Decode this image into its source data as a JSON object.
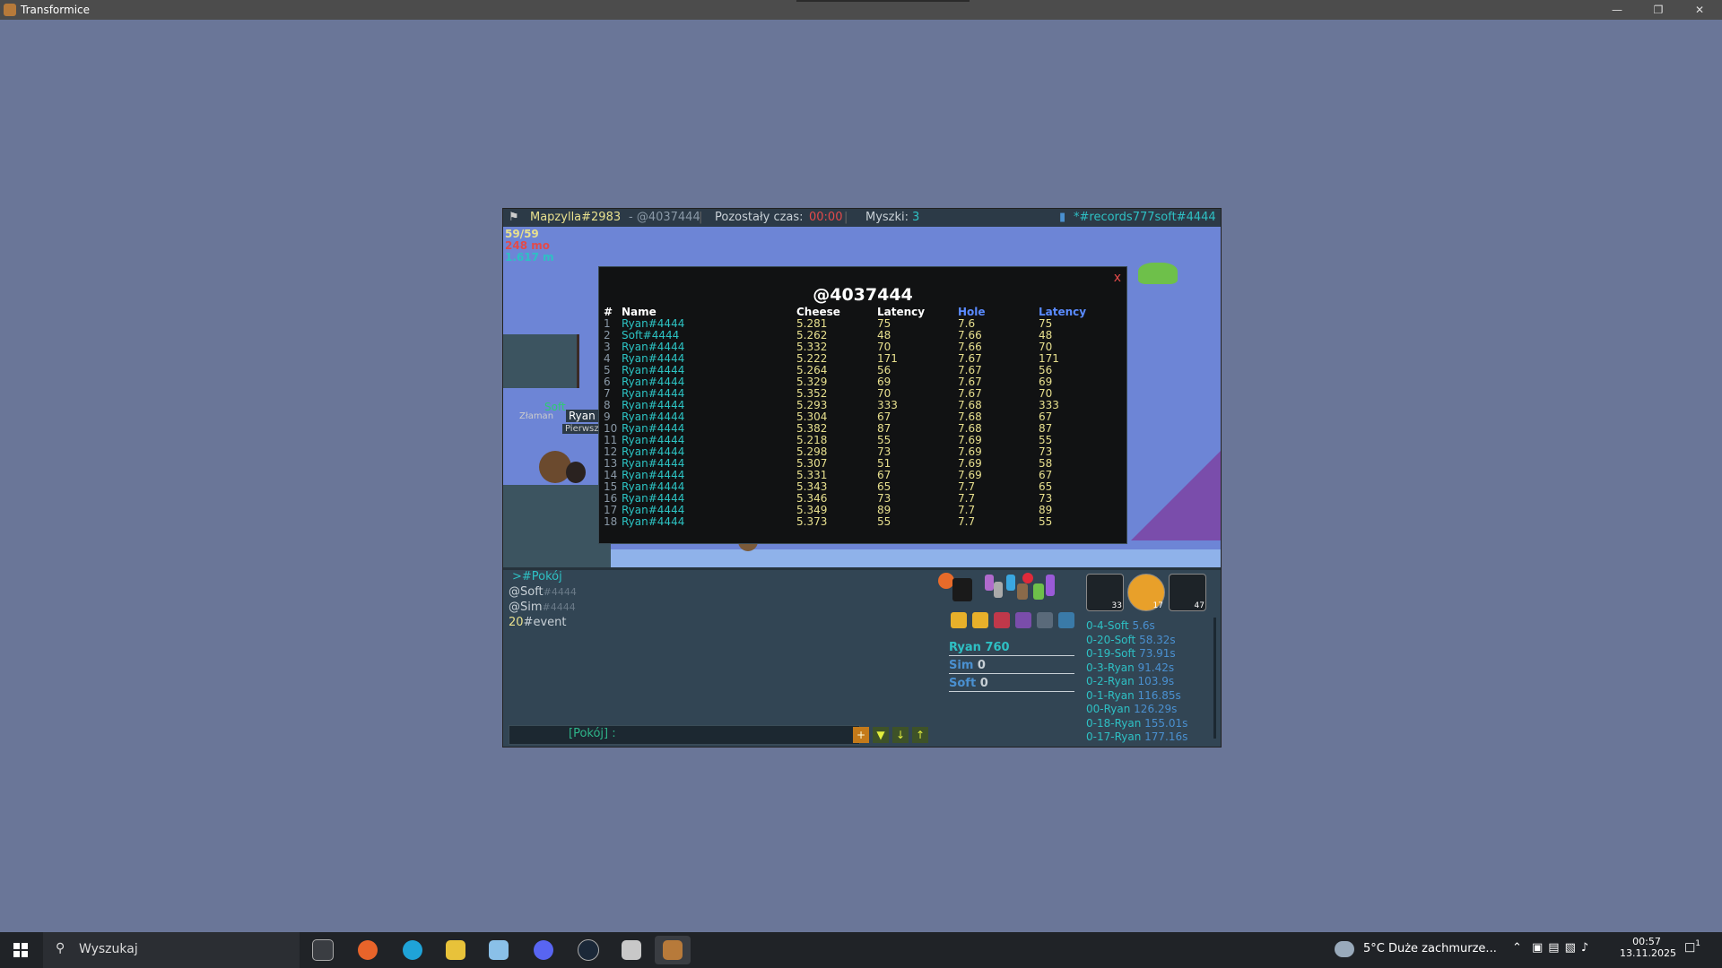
{
  "window": {
    "title": "Transformice"
  },
  "game": {
    "topbar": {
      "map": "Mapzylla#2983",
      "map_code": "- @4037444",
      "time_label": "Pozostały czas:",
      "time_value": "00:00",
      "mice_label": "Myszki:",
      "mice_value": "3",
      "room": "*#records777soft#4444"
    },
    "stats": {
      "line1": "59/59",
      "line2": "248 mo",
      "line3": "1.617 m"
    },
    "map_labels": {
      "soft": "Soft",
      "ryan": "Ryan",
      "zlaman": "Złaman",
      "pierwsz": "Pierwsz"
    },
    "panel": {
      "title": "@4037444",
      "close": "x",
      "headers": [
        "#",
        "Name",
        "Cheese",
        "Latency",
        "Hole",
        "Latency"
      ],
      "rows": [
        [
          "1",
          "Ryan#4444",
          "5.281",
          "75",
          "7.6",
          "75"
        ],
        [
          "2",
          "Soft#4444",
          "5.262",
          "48",
          "7.66",
          "48"
        ],
        [
          "3",
          "Ryan#4444",
          "5.332",
          "70",
          "7.66",
          "70"
        ],
        [
          "4",
          "Ryan#4444",
          "5.222",
          "171",
          "7.67",
          "171"
        ],
        [
          "5",
          "Ryan#4444",
          "5.264",
          "56",
          "7.67",
          "56"
        ],
        [
          "6",
          "Ryan#4444",
          "5.329",
          "69",
          "7.67",
          "69"
        ],
        [
          "7",
          "Ryan#4444",
          "5.352",
          "70",
          "7.67",
          "70"
        ],
        [
          "8",
          "Ryan#4444",
          "5.293",
          "333",
          "7.68",
          "333"
        ],
        [
          "9",
          "Ryan#4444",
          "5.304",
          "67",
          "7.68",
          "67"
        ],
        [
          "10",
          "Ryan#4444",
          "5.382",
          "87",
          "7.68",
          "87"
        ],
        [
          "11",
          "Ryan#4444",
          "5.218",
          "55",
          "7.69",
          "55"
        ],
        [
          "12",
          "Ryan#4444",
          "5.298",
          "73",
          "7.69",
          "73"
        ],
        [
          "13",
          "Ryan#4444",
          "5.307",
          "51",
          "7.69",
          "58"
        ],
        [
          "14",
          "Ryan#4444",
          "5.331",
          "67",
          "7.69",
          "67"
        ],
        [
          "15",
          "Ryan#4444",
          "5.343",
          "65",
          "7.7",
          "65"
        ],
        [
          "16",
          "Ryan#4444",
          "5.346",
          "73",
          "7.7",
          "73"
        ],
        [
          "17",
          "Ryan#4444",
          "5.349",
          "89",
          "7.7",
          "89"
        ],
        [
          "18",
          "Ryan#4444",
          "5.373",
          "55",
          "7.7",
          "55"
        ]
      ]
    },
    "chat": {
      "room": ">#Pokój",
      "soft": "@Soft",
      "soft_tag": "#4444",
      "sim": "@Sim",
      "sim_tag": "#4444",
      "event_num": "20",
      "event": "#event",
      "input_prefix": "[Pokój] :"
    },
    "big_icons": [
      {
        "name": "cheese-icon",
        "count": "33"
      },
      {
        "name": "orb-icon",
        "count": "17"
      },
      {
        "name": "magnifier-icon",
        "count": "47"
      }
    ],
    "scores": [
      {
        "name": "Ryan",
        "score": "760",
        "color": "#2ec0c4"
      },
      {
        "name": "Sim",
        "score": "0",
        "color": "#4a90d0"
      },
      {
        "name": "Soft",
        "score": "0",
        "color": "#4a90d0"
      }
    ],
    "log": [
      {
        "label": "0-4-Soft",
        "time": "5.6s"
      },
      {
        "label": "0-20-Soft",
        "time": "58.32s"
      },
      {
        "label": "0-19-Soft",
        "time": "73.91s"
      },
      {
        "label": "0-3-Ryan",
        "time": "91.42s"
      },
      {
        "label": "0-2-Ryan",
        "time": "103.9s"
      },
      {
        "label": "0-1-Ryan",
        "time": "116.85s"
      },
      {
        "label": "00-Ryan",
        "time": "126.29s"
      },
      {
        "label": "0-18-Ryan",
        "time": "155.01s"
      },
      {
        "label": "0-17-Ryan",
        "time": "177.16s"
      }
    ]
  },
  "taskbar": {
    "search_placeholder": "Wyszukaj",
    "weather": "5°C  Duże zachmurze...",
    "time": "00:57",
    "date": "13.11.2025",
    "notifications": "1",
    "apps": [
      "taskview-icon",
      "firefox-icon",
      "edge-icon",
      "explorer-icon",
      "notes-icon",
      "discord-icon",
      "steam-icon",
      "app-icon",
      "transformice-icon"
    ]
  }
}
